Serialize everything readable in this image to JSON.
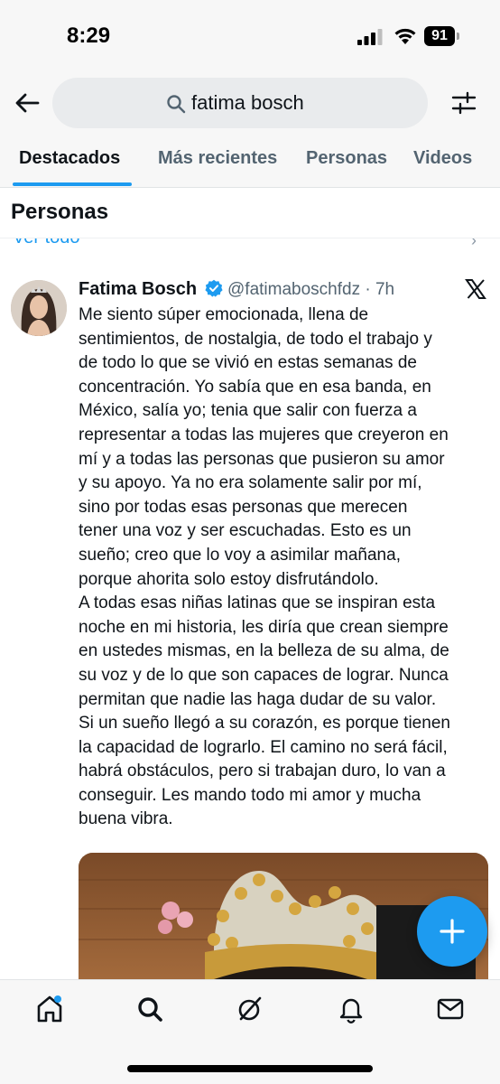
{
  "status_bar": {
    "time": "8:29",
    "battery": "91",
    "icons": [
      "signal-icon",
      "wifi-icon",
      "battery-icon"
    ]
  },
  "search": {
    "query": "fatima bosch",
    "icons": [
      "back-arrow-icon",
      "search-icon",
      "filter-sliders-icon"
    ]
  },
  "tabs": [
    {
      "label": "Destacados",
      "active": true
    },
    {
      "label": "Más recientes",
      "active": false
    },
    {
      "label": "Personas",
      "active": false
    },
    {
      "label": "Videos",
      "active": false
    }
  ],
  "section": {
    "title": "Personas",
    "see_all": "Ver todo"
  },
  "post": {
    "author": "Fatima Bosch",
    "handle_time": "@fatimaboschfdz · 7h",
    "verified_color": "#1d9bf0",
    "lines": [
      "Me siento súper emocionada, llena de",
      "sentimientos, de nostalgia, de todo el trabajo y",
      "de todo lo que se vivió en estas semanas de",
      "concentración. Yo sabía que en esa banda, en",
      "México, salía yo; tenia que salir con fuerza a",
      "representar a todas las mujeres que creyeron en",
      "mí y a todas las personas que pusieron su amor",
      "y su apoyo. Ya no era solamente salir por mí,",
      "sino por todas esas personas que merecen",
      "tener una voz y ser escuchadas. Esto es un",
      "sueño; creo que lo voy a asimilar mañana,",
      "porque ahorita solo estoy disfrutándolo.",
      "A todas esas niñas latinas que se inspiran esta",
      "noche en mi historia, les diría que crean siempre",
      "en ustedes mismas, en la belleza de su alma, de",
      "su voz y de lo que son capaces de lograr. Nunca",
      "permitan que nadie las haga dudar de su valor.",
      "Si un sueño llegó a su corazón, es porque tienen",
      "la capacidad de lograrlo. El camino no será fácil,",
      "habrá obstáculos, pero si trabajan duro, lo van a",
      "conseguir. Les mando todo mi amor y mucha",
      "buena vibra."
    ]
  },
  "nav": {
    "items": [
      "home-icon",
      "search-icon",
      "grok-icon",
      "notifications-icon",
      "messages-icon"
    ]
  },
  "colors": {
    "accent": "#1d9bf0",
    "text": "#0f1419",
    "secondary": "#536471"
  }
}
